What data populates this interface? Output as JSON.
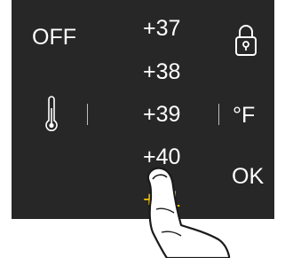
{
  "controls": {
    "power_label": "OFF",
    "unit_label": "°F",
    "confirm_label": "OK"
  },
  "picker": {
    "values": [
      "+37",
      "+38",
      "+39",
      "+40",
      "+41"
    ],
    "selected_index": 4
  },
  "icons": {
    "lock": "lock-icon",
    "temperature": "thermometer-icon",
    "gesture": "finger-tap-icon"
  },
  "colors": {
    "panel_background": "#272727",
    "text": "#ffffff",
    "highlight": "#f2c300"
  }
}
